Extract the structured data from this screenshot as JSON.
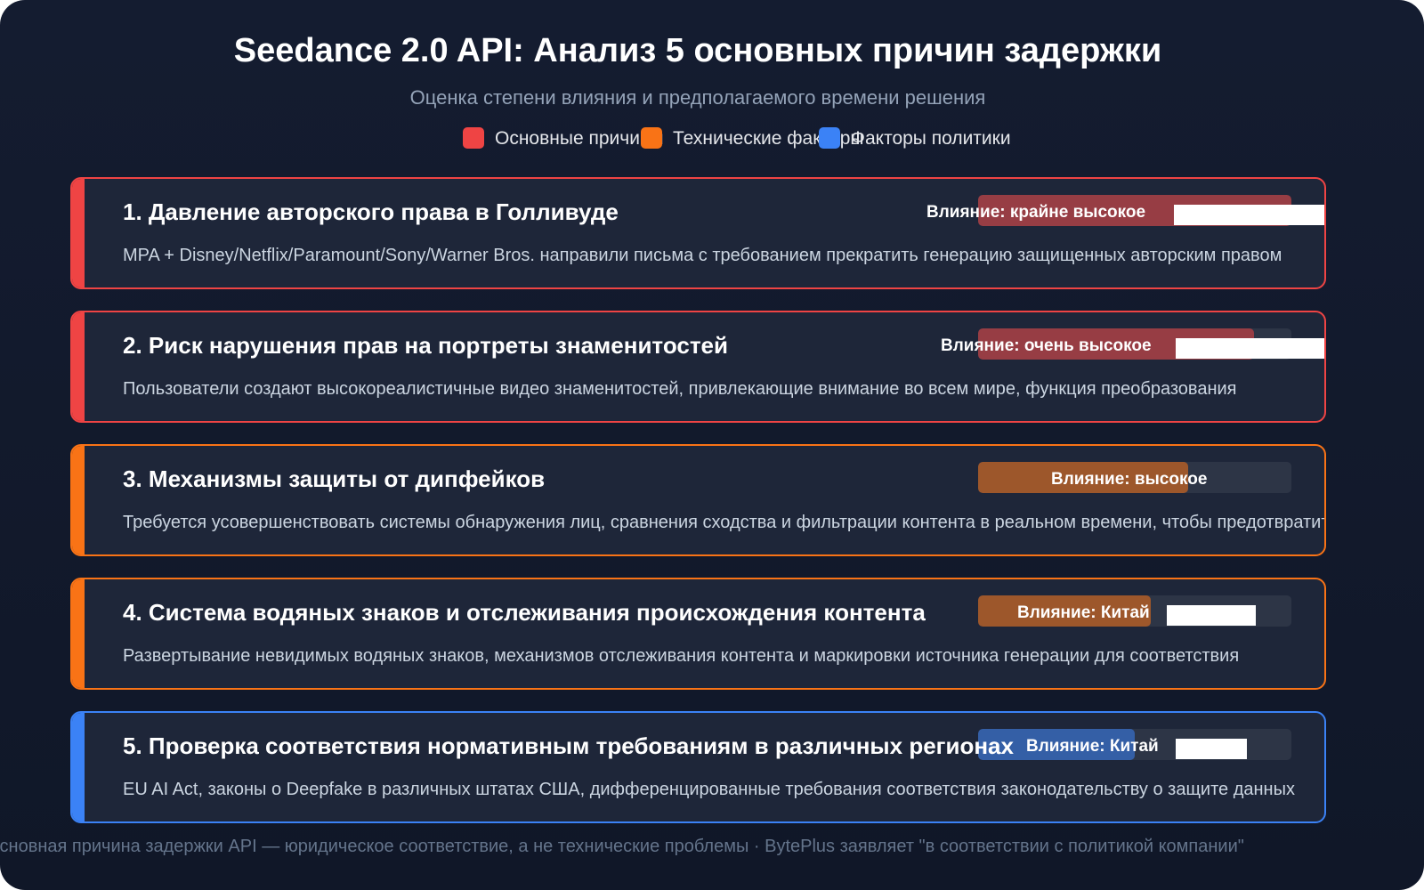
{
  "title": "Seedance 2.0 API: Анализ 5 основных причин задержки",
  "subtitle": "Оценка степени влияния и предполагаемого времени решения",
  "legend": [
    {
      "label": "Основные причины",
      "color": "#ef4444"
    },
    {
      "label": "Технические факторы",
      "color": "#f97316"
    },
    {
      "label": "Факторы политики",
      "color": "#3b82f6"
    }
  ],
  "cards": [
    {
      "title": "1. Давление авторского права в Голливуде",
      "description": "MPA + Disney/Netflix/Paramount/Sony/Warner Bros. направили письма с требованием прекратить генерацию защищенных авторским правом",
      "impact_label": "Влияние: крайне высокое",
      "impact_level": 1.0,
      "category": "Основные причины",
      "color": "#ef4444"
    },
    {
      "title": "2. Риск нарушения прав на портреты знаменитостей",
      "description": "Пользователи создают высокореалистичные видео знаменитостей, привлекающие внимание во всем мире, функция преобразования",
      "impact_label": "Влияние: очень высокое",
      "impact_level": 0.88,
      "category": "Основные причины",
      "color": "#ef4444"
    },
    {
      "title": "3. Механизмы защиты от дипфейков",
      "description": "Требуется усовершенствовать системы обнаружения лиц, сравнения сходства и фильтрации контента в реальном времени, чтобы предотвратить",
      "impact_label": "Влияние: высокое",
      "impact_level": 0.67,
      "category": "Технические факторы",
      "color": "#f97316"
    },
    {
      "title": "4. Система водяных знаков и отслеживания происхождения контента",
      "description": "Развертывание невидимых водяных знаков, механизмов отслеживания контента и маркировки источника генерации для соответствия",
      "impact_label": "Влияние: Китай",
      "impact_level": 0.55,
      "category": "Технические факторы",
      "color": "#f97316"
    },
    {
      "title": "5. Проверка соответствия нормативным требованиям в различных регионах",
      "description": "EU AI Act, законы о Deepfake в различных штатах США, дифференцированные требования соответствия законодательству о защите данных",
      "impact_label": "Влияние: Китай",
      "impact_level": 0.5,
      "category": "Факторы политики",
      "color": "#3b82f6"
    }
  ],
  "footer": "Основная причина задержки API — юридическое соответствие, а не технические проблемы · BytePlus заявляет \"в соответствии с политикой компании\""
}
